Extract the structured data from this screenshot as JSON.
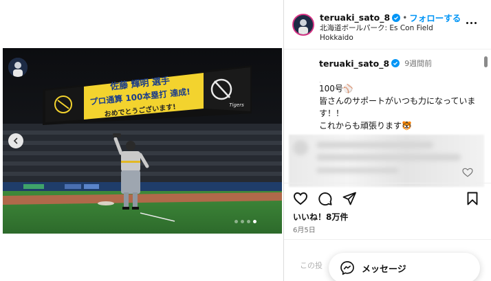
{
  "header": {
    "username": "teruaki_sato_8",
    "separator": "•",
    "follow_label": "フォローする",
    "location": "北海道ボールパーク: Es Con Field Hokkaido"
  },
  "post": {
    "username": "teruaki_sato_8",
    "time_ago": "9週間前",
    "caption_dot": ".",
    "caption_lines": [
      "100号⚾",
      "皆さんのサポートがいつも力になっています！！",
      "これからも頑張ります🐯"
    ]
  },
  "media": {
    "scoreboard_line1": "佐藤 輝明 選手",
    "scoreboard_line2": "プロ通算 100本塁打 達成!",
    "scoreboard_line3": "おめでとうございます!",
    "scoreboard_logo": "Tigers",
    "carousel": {
      "total": 4,
      "active_index": 3
    }
  },
  "engagement": {
    "likes_label": "いいね！8万件",
    "date": "6月5日",
    "comment_placeholder": "この投"
  },
  "message_button": {
    "label": "メッセージ"
  },
  "icons": [
    "verified-badge-icon",
    "more-options-icon",
    "heart-icon",
    "comment-icon",
    "share-icon",
    "bookmark-icon",
    "chevron-left-icon",
    "messenger-icon"
  ],
  "colors": {
    "accent": "#0095f6",
    "verified": "#0095f6",
    "scoreboard_yellow": "#f3d32e"
  }
}
